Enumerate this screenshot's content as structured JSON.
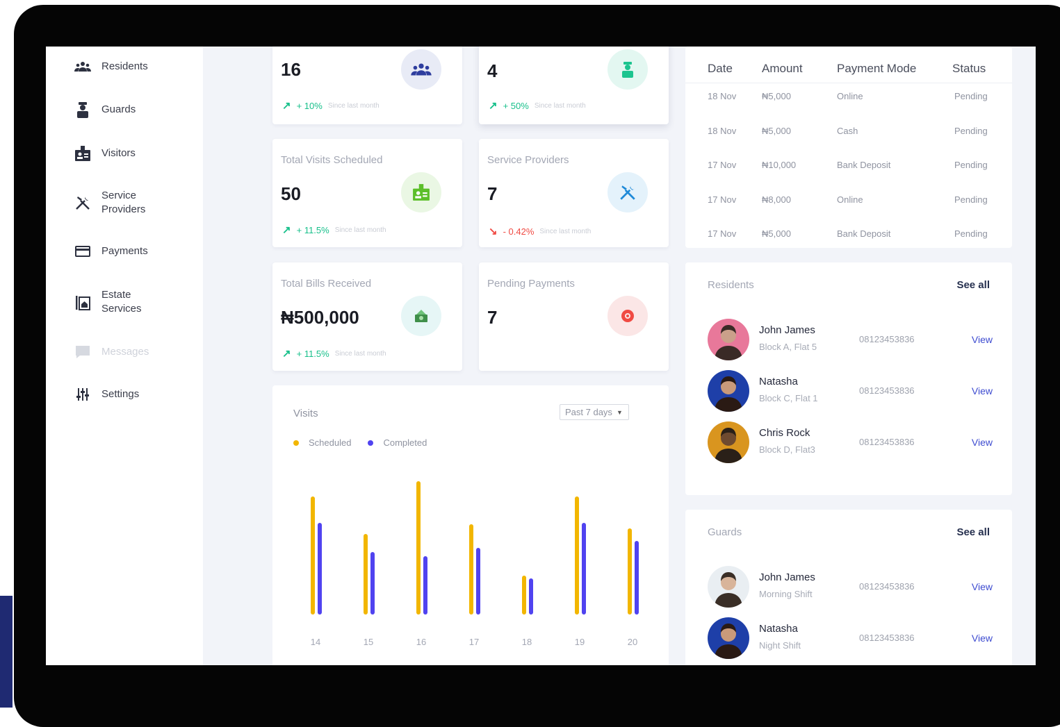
{
  "colors": {
    "scheduled": "#f2b600",
    "completed": "#5043f0",
    "trend_up": "#18c08b",
    "trend_down": "#f04a43",
    "link": "#3d4bd0"
  },
  "sidebar": {
    "items": [
      {
        "label": "Residents",
        "icon": "people-icon"
      },
      {
        "label": "Guards",
        "icon": "guard-icon"
      },
      {
        "label": "Visitors",
        "icon": "badge-icon"
      },
      {
        "label": "Service Providers",
        "icon": "tools-icon"
      },
      {
        "label": "Payments",
        "icon": "card-icon"
      },
      {
        "label": "Estate Services",
        "icon": "building-icon"
      },
      {
        "label": "Messages",
        "icon": "message-icon",
        "disabled": true
      },
      {
        "label": "Settings",
        "icon": "sliders-icon"
      }
    ]
  },
  "stats": {
    "residents": {
      "value": "16",
      "change": "+ 10%",
      "since": "Since last month"
    },
    "guards": {
      "value": "4",
      "change": "+ 50%",
      "since": "Since last month"
    },
    "visits": {
      "title": "Total Visits Scheduled",
      "value": "50",
      "change": "+ 11.5%",
      "since": "Since last month"
    },
    "providers": {
      "title": "Service Providers",
      "value": "7",
      "change": "- 0.42%",
      "since": "Since last month"
    },
    "bills": {
      "title": "Total Bills Received",
      "value": "₦500,000",
      "change": "+ 11.5%",
      "since": "Since last month"
    },
    "pending": {
      "title": "Pending Payments",
      "value": "7"
    }
  },
  "payments": {
    "headers": [
      "Date",
      "Amount",
      "Payment Mode",
      "Status"
    ],
    "rows": [
      [
        "18 Nov",
        "₦5,000",
        "Online",
        "Pending"
      ],
      [
        "18 Nov",
        "₦5,000",
        "Cash",
        "Pending"
      ],
      [
        "17 Nov",
        "₦10,000",
        "Bank Deposit",
        "Pending"
      ],
      [
        "17 Nov",
        "₦8,000",
        "Online",
        "Pending"
      ],
      [
        "17 Nov",
        "₦5,000",
        "Bank Deposit",
        "Pending"
      ]
    ]
  },
  "residents": {
    "title": "Residents",
    "see_all": "See all",
    "people": [
      {
        "name": "John James",
        "sub": "Block A, Flat 5",
        "phone": "08123453836",
        "action": "View"
      },
      {
        "name": "Natasha",
        "sub": "Block C, Flat 1",
        "phone": "08123453836",
        "action": "View"
      },
      {
        "name": "Chris Rock",
        "sub": "Block D, Flat3",
        "phone": "08123453836",
        "action": "View"
      }
    ]
  },
  "guards": {
    "title": "Guards",
    "see_all": "See all",
    "people": [
      {
        "name": "John James",
        "sub": "Morning Shift",
        "phone": "08123453836",
        "action": "View"
      },
      {
        "name": "Natasha",
        "sub": "Night Shift",
        "phone": "08123453836",
        "action": "View"
      }
    ]
  },
  "chart_panel": {
    "title": "Visits",
    "range": "Past 7 days"
  },
  "chart_data": {
    "type": "bar",
    "categories": [
      "14",
      "15",
      "16",
      "17",
      "18",
      "19",
      "20"
    ],
    "series": [
      {
        "name": "Scheduled",
        "values": [
          85,
          58,
          96,
          65,
          28,
          85,
          62
        ]
      },
      {
        "name": "Completed",
        "values": [
          66,
          45,
          42,
          48,
          26,
          66,
          53
        ]
      }
    ],
    "ylim": [
      0,
      100
    ],
    "grid": false,
    "legend_position": "top-left"
  }
}
